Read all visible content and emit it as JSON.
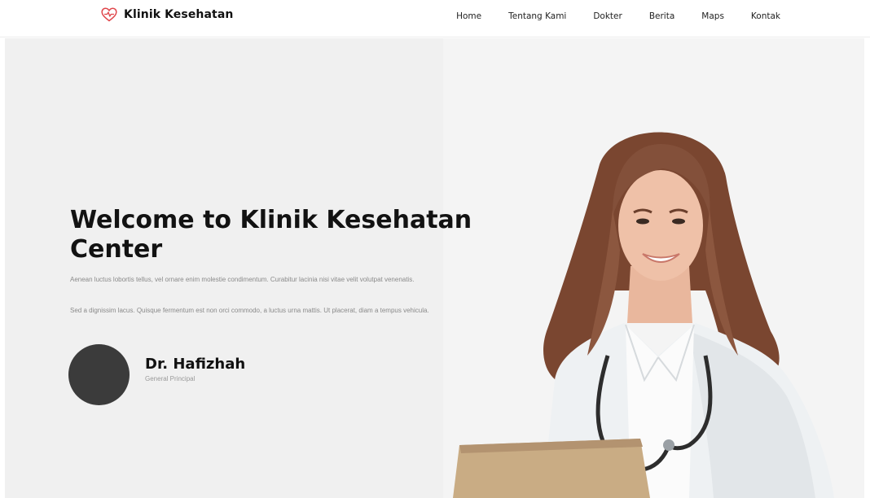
{
  "brand": {
    "name": "Klinik Kesehatan",
    "icon": "heart-pulse-icon",
    "color": "#e0474c"
  },
  "nav": {
    "items": [
      {
        "label": "Home"
      },
      {
        "label": "Tentang Kami"
      },
      {
        "label": "Dokter"
      },
      {
        "label": "Berita"
      },
      {
        "label": "Maps"
      },
      {
        "label": "Kontak"
      }
    ]
  },
  "hero": {
    "title": "Welcome to Klinik Kesehatan Center",
    "paragraph_1": "Aenean luctus lobortis tellus, vel ornare enim molestie condimentum. Curabitur lacinia nisi vitae velit volutpat venenatis.",
    "paragraph_2": "Sed a dignissim lacus. Quisque fermentum est non orci commodo, a luctus urna mattis. Ut placerat, diam a tempus vehicula."
  },
  "profile": {
    "name": "Dr. Hafizhah",
    "role": "General Principal"
  },
  "colors": {
    "hero_background": "#f0f0f0",
    "avatar": "#3b3b3b"
  }
}
